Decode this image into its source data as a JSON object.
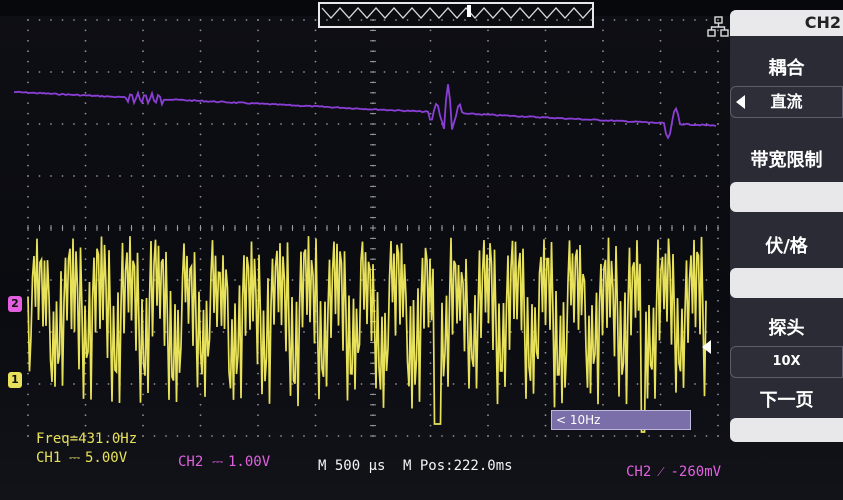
{
  "channel_header": "CH2",
  "menu": {
    "coupling": {
      "title": "耦合",
      "value": "直流"
    },
    "bandwidth_limit": {
      "title": "带宽限制",
      "value": ""
    },
    "volts_div": {
      "title": "伏/格",
      "value": ""
    },
    "probe": {
      "title": "探头",
      "value": "10X"
    },
    "next_page": {
      "title": "下一页",
      "value": ""
    }
  },
  "status": {
    "freq": "Freq=431.0Hz",
    "ch1": "CH1",
    "ch1_scale": "5.00V",
    "ch2": "CH2",
    "ch2_scale": "1.00V",
    "timebase": "M 500 µs",
    "mpos": "M Pos:222.0ms",
    "trigger": "CH2 ⁄ -260mV"
  },
  "bw_badge": "< 10Hz",
  "markers": {
    "ch1": "1",
    "ch2": "2"
  },
  "colors": {
    "ch1": "#e8e25a",
    "ch2": "#8a3fd6",
    "grid": "#9a9aa2",
    "menu_bg": "#2b2c36",
    "badge": "#7a6fa8"
  }
}
